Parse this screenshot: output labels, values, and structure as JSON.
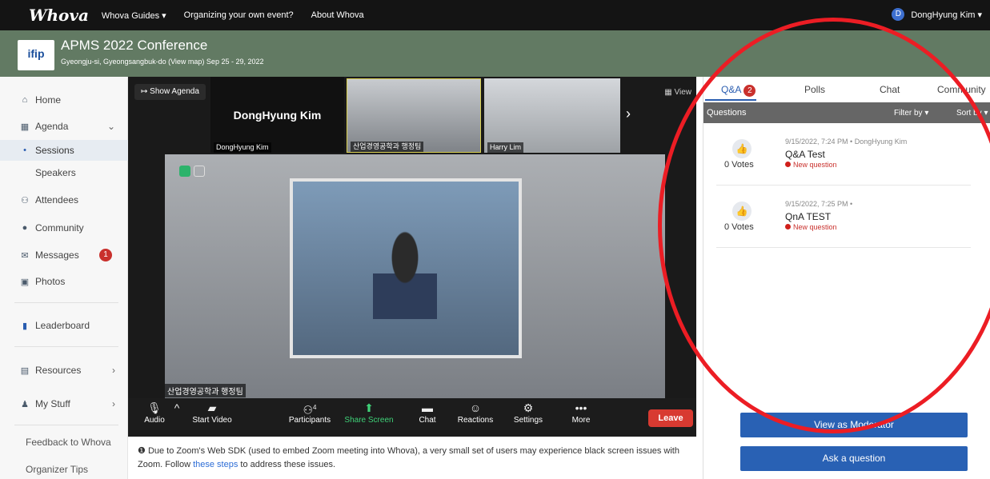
{
  "topbar": {
    "logo": "Whova",
    "nav": [
      "Whova Guides ▾",
      "Organizing your own event?",
      "About Whova"
    ],
    "user_initial": "D",
    "user_name": "DongHyung Kim ▾"
  },
  "event": {
    "logo_text": "ifip",
    "title": "APMS 2022 Conference",
    "subtitle": "Gyeongju-si, Gyeongsangbuk-do (View map)  Sep 25 - 29, 2022"
  },
  "sidebar": {
    "items": [
      {
        "icon": "home-icon",
        "glyph": "⌂",
        "label": "Home"
      },
      {
        "icon": "calendar-icon",
        "glyph": "▦",
        "label": "Agenda",
        "chevron": "⌄"
      },
      {
        "icon": "bullet-icon",
        "glyph": "•",
        "label": "Sessions"
      },
      {
        "icon": "",
        "glyph": "",
        "label": "Speakers"
      },
      {
        "icon": "attendees-icon",
        "glyph": "⚇",
        "label": "Attendees"
      },
      {
        "icon": "community-icon",
        "glyph": "●",
        "label": "Community"
      },
      {
        "icon": "mail-icon",
        "glyph": "✉",
        "label": "Messages",
        "badge": "1"
      },
      {
        "icon": "camera-icon",
        "glyph": "▣",
        "label": "Photos"
      },
      {
        "icon": "leaderboard-icon",
        "glyph": "▮",
        "label": "Leaderboard"
      },
      {
        "icon": "resources-icon",
        "glyph": "▤",
        "label": "Resources",
        "chevron": "›"
      },
      {
        "icon": "user-icon",
        "glyph": "♟",
        "label": "My Stuff",
        "chevron": "›"
      }
    ],
    "footer": [
      "Feedback to Whova",
      "Organizer Tips"
    ]
  },
  "video": {
    "show_agenda": "Show Agenda",
    "view_label": "View",
    "active_speaker": "DongHyung Kim",
    "tiles": [
      "DongHyung Kim",
      "산업경영공학과 행정팀",
      "Harry Lim"
    ],
    "main_label": "산업경영공학과 행정팀",
    "controls": [
      {
        "glyph": "🎙",
        "label": "Audio",
        "icon": "microphone-icon"
      },
      {
        "glyph": "^",
        "label": "",
        "icon": "caret-up-icon"
      },
      {
        "glyph": "⃠",
        "label": "Start Video",
        "icon": "video-off-icon"
      },
      {
        "glyph": "👥",
        "label": "Participants",
        "icon": "participants-icon",
        "count": "4"
      },
      {
        "glyph": "⬆",
        "label": "Share Screen",
        "icon": "share-screen-icon"
      },
      {
        "glyph": "💬",
        "label": "Chat",
        "icon": "chat-icon"
      },
      {
        "glyph": "☺",
        "label": "Reactions",
        "icon": "reactions-icon"
      },
      {
        "glyph": "⚙",
        "label": "Settings",
        "icon": "settings-icon"
      },
      {
        "glyph": "•••",
        "label": "More",
        "icon": "more-icon"
      }
    ],
    "leave": "Leave"
  },
  "notice": {
    "text_before": "Due to Zoom's Web SDK (used to embed Zoom meeting into Whova), a very small set of users may experience black screen issues with Zoom. Follow ",
    "link": "these steps",
    "text_after": " to address these issues."
  },
  "panel": {
    "tabs": [
      {
        "label": "Q&A",
        "badge": "2"
      },
      {
        "label": "Polls"
      },
      {
        "label": "Chat"
      },
      {
        "label": "Community"
      }
    ],
    "questions_label": "Questions",
    "filter_label": "Filter by ▾",
    "sort_label": "Sort by ▾",
    "questions": [
      {
        "meta": "9/15/2022, 7:24 PM • DongHyung Kim",
        "text": "Q&A Test",
        "status": "New question",
        "votes": "0  Votes"
      },
      {
        "meta": "9/15/2022, 7:25 PM •",
        "text": "QnA TEST",
        "status": "New question",
        "votes": "0  Votes"
      }
    ],
    "moderator_button": "View as Moderator",
    "ask_button": "Ask a question"
  },
  "colors": {
    "annotation_circle": "#ec1d24",
    "primary": "#2961b4",
    "banner": "#627a63"
  }
}
